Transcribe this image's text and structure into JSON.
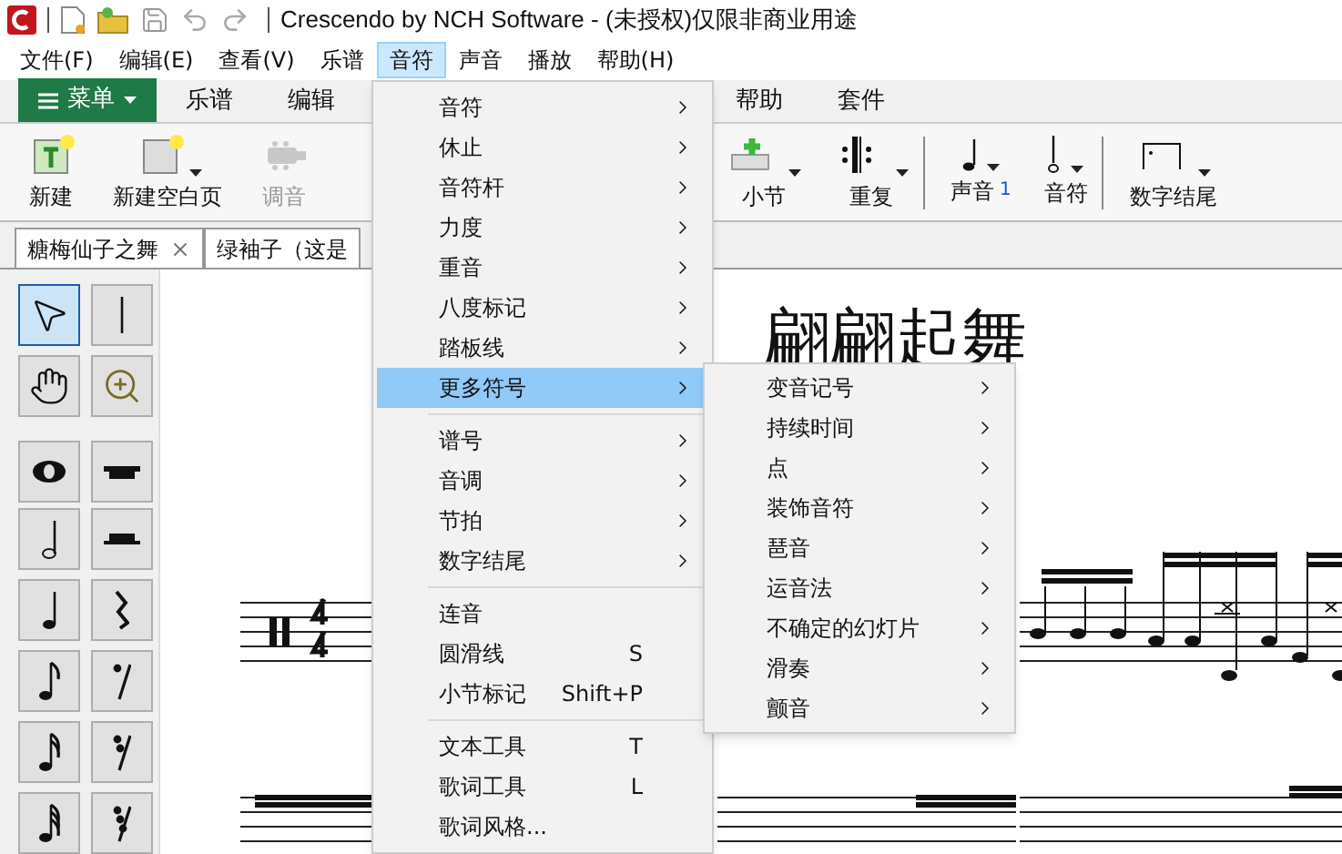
{
  "window": {
    "title": "Crescendo by NCH Software - (未授权)仅限非商业用途"
  },
  "menu_bar": [
    {
      "label": "文件(F)",
      "selected": false
    },
    {
      "label": "编辑(E)",
      "selected": false
    },
    {
      "label": "查看(V)",
      "selected": false
    },
    {
      "label": "乐谱",
      "selected": false
    },
    {
      "label": "音符",
      "selected": true
    },
    {
      "label": "声音",
      "selected": false
    },
    {
      "label": "播放",
      "selected": false
    },
    {
      "label": "帮助(H)",
      "selected": false
    }
  ],
  "ribbon": {
    "menu_button": "菜单",
    "tabs": [
      {
        "label": "乐谱",
        "selected": false
      },
      {
        "label": "编辑",
        "selected": false
      },
      {
        "label": "帮助",
        "selected": false
      },
      {
        "label": "套件",
        "selected": false
      }
    ]
  },
  "toolbar_left": [
    {
      "kind": "new",
      "label": "新建",
      "dropdown": false,
      "disabled": false
    },
    {
      "kind": "blank-page",
      "label": "新建空白页",
      "dropdown": true,
      "disabled": false
    },
    {
      "kind": "tuner",
      "label": "调音",
      "dropdown": false,
      "disabled": true
    }
  ],
  "toolbar_right": [
    [
      {
        "kind": "measure",
        "label": "小节",
        "dropdown": true
      },
      {
        "kind": "repeat",
        "label": "重复",
        "dropdown": true
      }
    ],
    [
      {
        "kind": "voice",
        "label": "声音",
        "badge": "1",
        "dropdown": true
      },
      {
        "kind": "note",
        "label": "音符",
        "dropdown": true
      }
    ],
    [
      {
        "kind": "ending",
        "label": "数字结尾",
        "dropdown": true
      }
    ]
  ],
  "document_tabs": [
    {
      "label": "糖梅仙子之舞",
      "closable": true
    },
    {
      "label": "绿袖子（这是",
      "closable": false
    }
  ],
  "tools": [
    {
      "kind": "pointer",
      "selected": true
    },
    {
      "kind": "text-cursor",
      "selected": false
    },
    {
      "kind": "hand",
      "selected": false
    },
    {
      "kind": "zoom",
      "selected": false
    },
    {
      "kind": "whole-note",
      "selected": false
    },
    {
      "kind": "whole-rest",
      "selected": false
    },
    {
      "kind": "half-note",
      "selected": false
    },
    {
      "kind": "half-rest",
      "selected": false
    },
    {
      "kind": "quarter-note",
      "selected": false
    },
    {
      "kind": "quarter-rest",
      "selected": false
    },
    {
      "kind": "eighth-note",
      "selected": false
    },
    {
      "kind": "eighth-rest",
      "selected": false
    },
    {
      "kind": "sixteenth-note",
      "selected": false
    },
    {
      "kind": "sixteenth-rest",
      "selected": false
    },
    {
      "kind": "thirty-second-note",
      "selected": false
    },
    {
      "kind": "thirty-second-rest",
      "selected": false
    }
  ],
  "score": {
    "title": "翩翩起舞"
  },
  "note_menu": [
    [
      {
        "label": "音符",
        "submenu": true,
        "selected": false
      },
      {
        "label": "休止",
        "submenu": true,
        "selected": false
      },
      {
        "label": "音符杆",
        "submenu": true,
        "selected": false
      },
      {
        "label": "力度",
        "submenu": true,
        "selected": false
      },
      {
        "label": "重音",
        "submenu": true,
        "selected": false
      },
      {
        "label": "八度标记",
        "submenu": true,
        "selected": false
      },
      {
        "label": "踏板线",
        "submenu": true,
        "selected": false
      },
      {
        "label": "更多符号",
        "submenu": true,
        "selected": true
      }
    ],
    [
      {
        "label": "谱号",
        "submenu": true,
        "selected": false
      },
      {
        "label": "音调",
        "submenu": true,
        "selected": false
      },
      {
        "label": "节拍",
        "submenu": true,
        "selected": false
      },
      {
        "label": "数字结尾",
        "submenu": true,
        "selected": false
      }
    ],
    [
      {
        "label": "连音",
        "submenu": false,
        "selected": false
      },
      {
        "label": "圆滑线",
        "shortcut": "S",
        "submenu": false,
        "selected": false
      },
      {
        "label": "小节标记",
        "shortcut": "Shift+P",
        "submenu": false,
        "selected": false
      }
    ],
    [
      {
        "label": "文本工具",
        "shortcut": "T",
        "submenu": false,
        "selected": false
      },
      {
        "label": "歌词工具",
        "shortcut": "L",
        "submenu": false,
        "selected": false
      },
      {
        "label": "歌词风格...",
        "submenu": false,
        "selected": false
      }
    ]
  ],
  "more_symbols_submenu": [
    {
      "label": "变音记号",
      "submenu": true
    },
    {
      "label": "持续时间",
      "submenu": true
    },
    {
      "label": "点",
      "submenu": true
    },
    {
      "label": "装饰音符",
      "submenu": true
    },
    {
      "label": "琶音",
      "submenu": true
    },
    {
      "label": "运音法",
      "submenu": true
    },
    {
      "label": "不确定的幻灯片",
      "submenu": true
    },
    {
      "label": "滑奏",
      "submenu": true
    },
    {
      "label": "颤音",
      "submenu": true
    }
  ]
}
